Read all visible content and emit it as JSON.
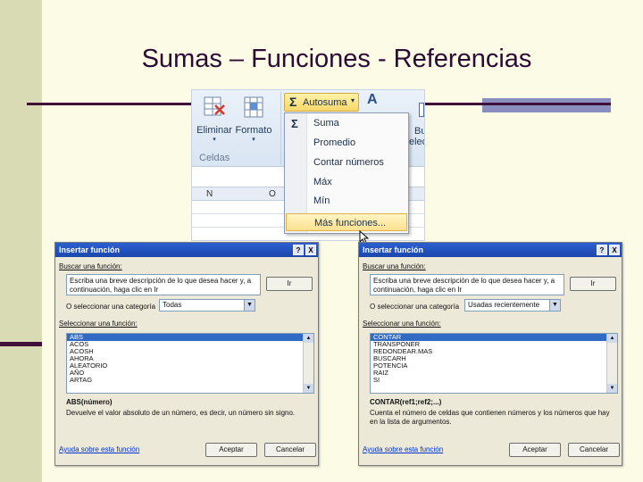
{
  "slide": {
    "title": "Sumas – Funciones - Referencias"
  },
  "colors": {
    "background": "#fbfbe6",
    "side_band": "#d8dbb3",
    "accent": "#3f0f3a",
    "rule_box": "#8a8ebe",
    "dialog_title": "#1c47ad",
    "selection": "#316ac5"
  },
  "ribbon": {
    "delete_label": "Eliminar",
    "format_label": "Formato",
    "group_label": "Celdas",
    "partial_label_1": "Bu",
    "partial_label_2": "elec",
    "autosum_label": "Autosuma",
    "columns": [
      "N",
      "O"
    ],
    "menu_items": [
      "Suma",
      "Promedio",
      "Contar números",
      "Máx",
      "Mín"
    ],
    "menu_selected": "Más funciones..."
  },
  "dialog_left": {
    "title": "Insertar función",
    "help_btn": "?",
    "close_btn": "X",
    "search_label": "Buscar una función:",
    "search_value": "Escriba una breve descripción de lo que desea hacer y, a continuación, haga clic en Ir",
    "go_button": "Ir",
    "category_label": "O seleccionar una categoría",
    "category_value": "Todas",
    "select_function_label": "Seleccionar una función:",
    "functions": [
      "ABS",
      "ACOS",
      "ACOSH",
      "AHORA",
      "ALEATORIO",
      "AÑO",
      "ARTAG"
    ],
    "selected_index": 0,
    "syntax": "ABS(número)",
    "description": "Devuelve el valor absoluto de un número, es decir, un número sin signo.",
    "help_link": "Ayuda sobre esta función",
    "ok_button": "Aceptar",
    "cancel_button": "Cancelar"
  },
  "dialog_right": {
    "title": "Insertar función",
    "help_btn": "?",
    "close_btn": "X",
    "search_label": "Buscar una función:",
    "search_value": "Escriba una breve descripción de lo que desea hacer y, a continuación, haga clic en Ir",
    "go_button": "Ir",
    "category_label": "O seleccionar una categoría",
    "category_value": "Usadas recientemente",
    "select_function_label": "Seleccionar una función:",
    "functions": [
      "CONTAR",
      "TRANSPONER",
      "REDONDEAR.MAS",
      "BUSCARH",
      "POTENCIA",
      "RAIZ",
      "SI"
    ],
    "selected_index": 0,
    "syntax": "CONTAR(ref1;ref2;...)",
    "description": "Cuenta el número de celdas que contienen números y los números que hay en la lista de argumentos.",
    "help_link": "Ayuda sobre esta función",
    "ok_button": "Aceptar",
    "cancel_button": "Cancelar"
  }
}
